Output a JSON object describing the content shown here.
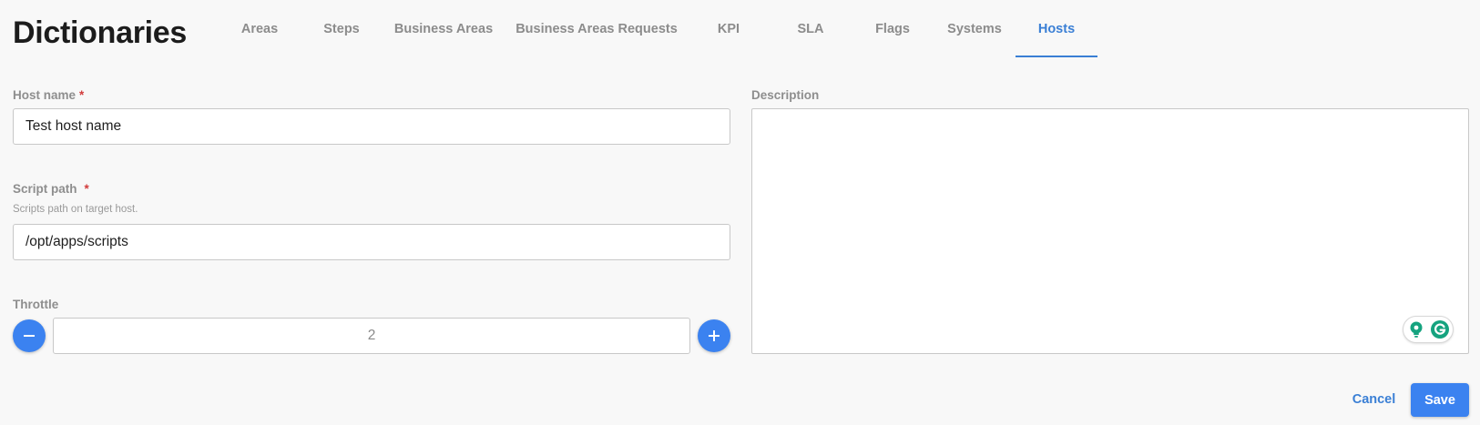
{
  "page": {
    "title": "Dictionaries"
  },
  "tabs": [
    {
      "label": "Areas",
      "active": false
    },
    {
      "label": "Steps",
      "active": false
    },
    {
      "label": "Business Areas",
      "active": false
    },
    {
      "label": "Business Areas Requests",
      "active": false
    },
    {
      "label": "KPI",
      "active": false
    },
    {
      "label": "SLA",
      "active": false
    },
    {
      "label": "Flags",
      "active": false
    },
    {
      "label": "Systems",
      "active": false
    },
    {
      "label": "Hosts",
      "active": true
    }
  ],
  "form": {
    "host_name": {
      "label": "Host name",
      "required_mark": "*",
      "value": "Test host name"
    },
    "script_path": {
      "label": "Script path",
      "required_mark": "*",
      "hint": "Scripts path on target host.",
      "value": "/opt/apps/scripts"
    },
    "throttle": {
      "label": "Throttle",
      "value": "2"
    },
    "description": {
      "label": "Description",
      "value": ""
    }
  },
  "actions": {
    "cancel_label": "Cancel",
    "save_label": "Save"
  },
  "colors": {
    "accent": "#3b82f0",
    "tab_active": "#3a7fd5",
    "required": "#d23c3c",
    "grammarly_green": "#15a37f"
  },
  "icons": {
    "decrement": "minus-icon",
    "increment": "plus-icon",
    "grammarly_suggest": "lightbulb-icon",
    "grammarly": "grammarly-g-icon"
  }
}
